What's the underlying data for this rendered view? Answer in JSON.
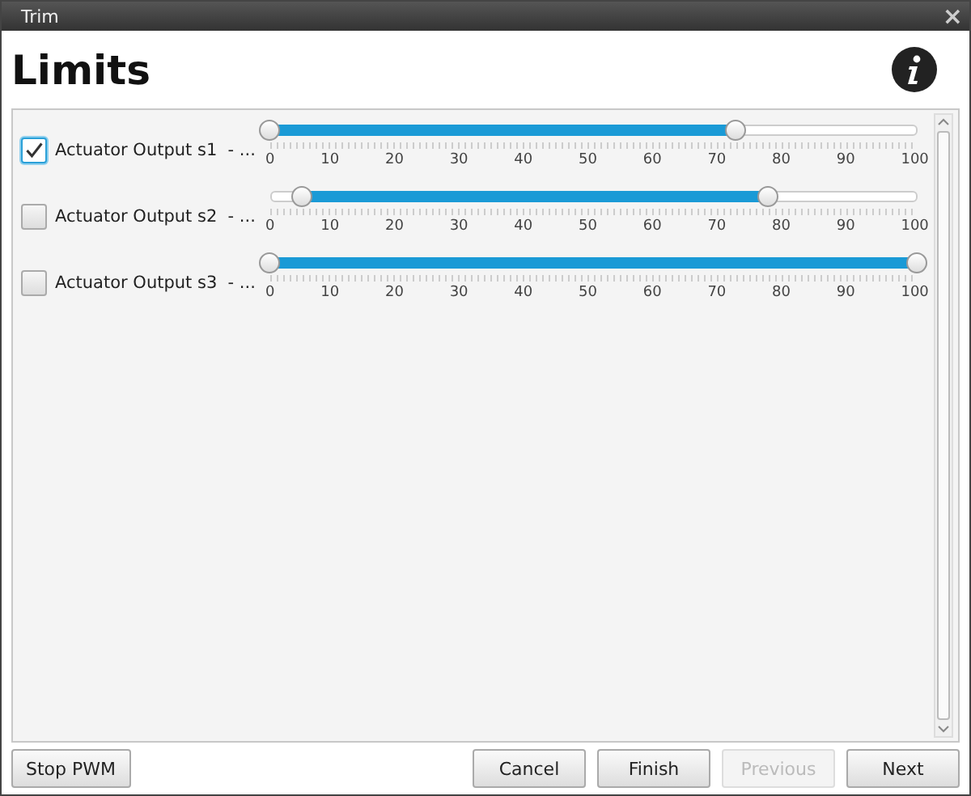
{
  "window": {
    "title": "Trim",
    "close": "×"
  },
  "heading": "Limits",
  "rows": [
    {
      "label": "Actuator Output s1  - ...",
      "checked": true,
      "thumbs": [
        {
          "level": 0
        },
        {
          "level": 0.72
        }
      ],
      "ticks": [
        "0",
        "10",
        "20",
        "30",
        "40",
        "50",
        "60",
        "70",
        "80",
        "90",
        "100"
      ]
    },
    {
      "label": "Actuator Output s2  - ...",
      "checked": false,
      "thumbs": [
        {
          "level": 0.05
        },
        {
          "level": 0.77
        }
      ],
      "ticks": [
        "0",
        "10",
        "20",
        "30",
        "40",
        "50",
        "60",
        "70",
        "80",
        "90",
        "100"
      ]
    },
    {
      "label": "Actuator Output s3  - ...",
      "checked": false,
      "thumbs": [
        {
          "level": 0
        },
        {
          "level": 1
        }
      ],
      "ticks": [
        "0",
        "10",
        "20",
        "30",
        "40",
        "50",
        "60",
        "70",
        "80",
        "90",
        "100"
      ]
    }
  ],
  "footer": {
    "left": [
      {
        "label": "Stop PWM",
        "disabled": false
      }
    ],
    "right": [
      {
        "label": "Cancel",
        "disabled": false
      },
      {
        "label": "Finish",
        "disabled": false
      },
      {
        "label": "Previous",
        "disabled": true
      },
      {
        "label": "Next",
        "disabled": false
      }
    ]
  }
}
